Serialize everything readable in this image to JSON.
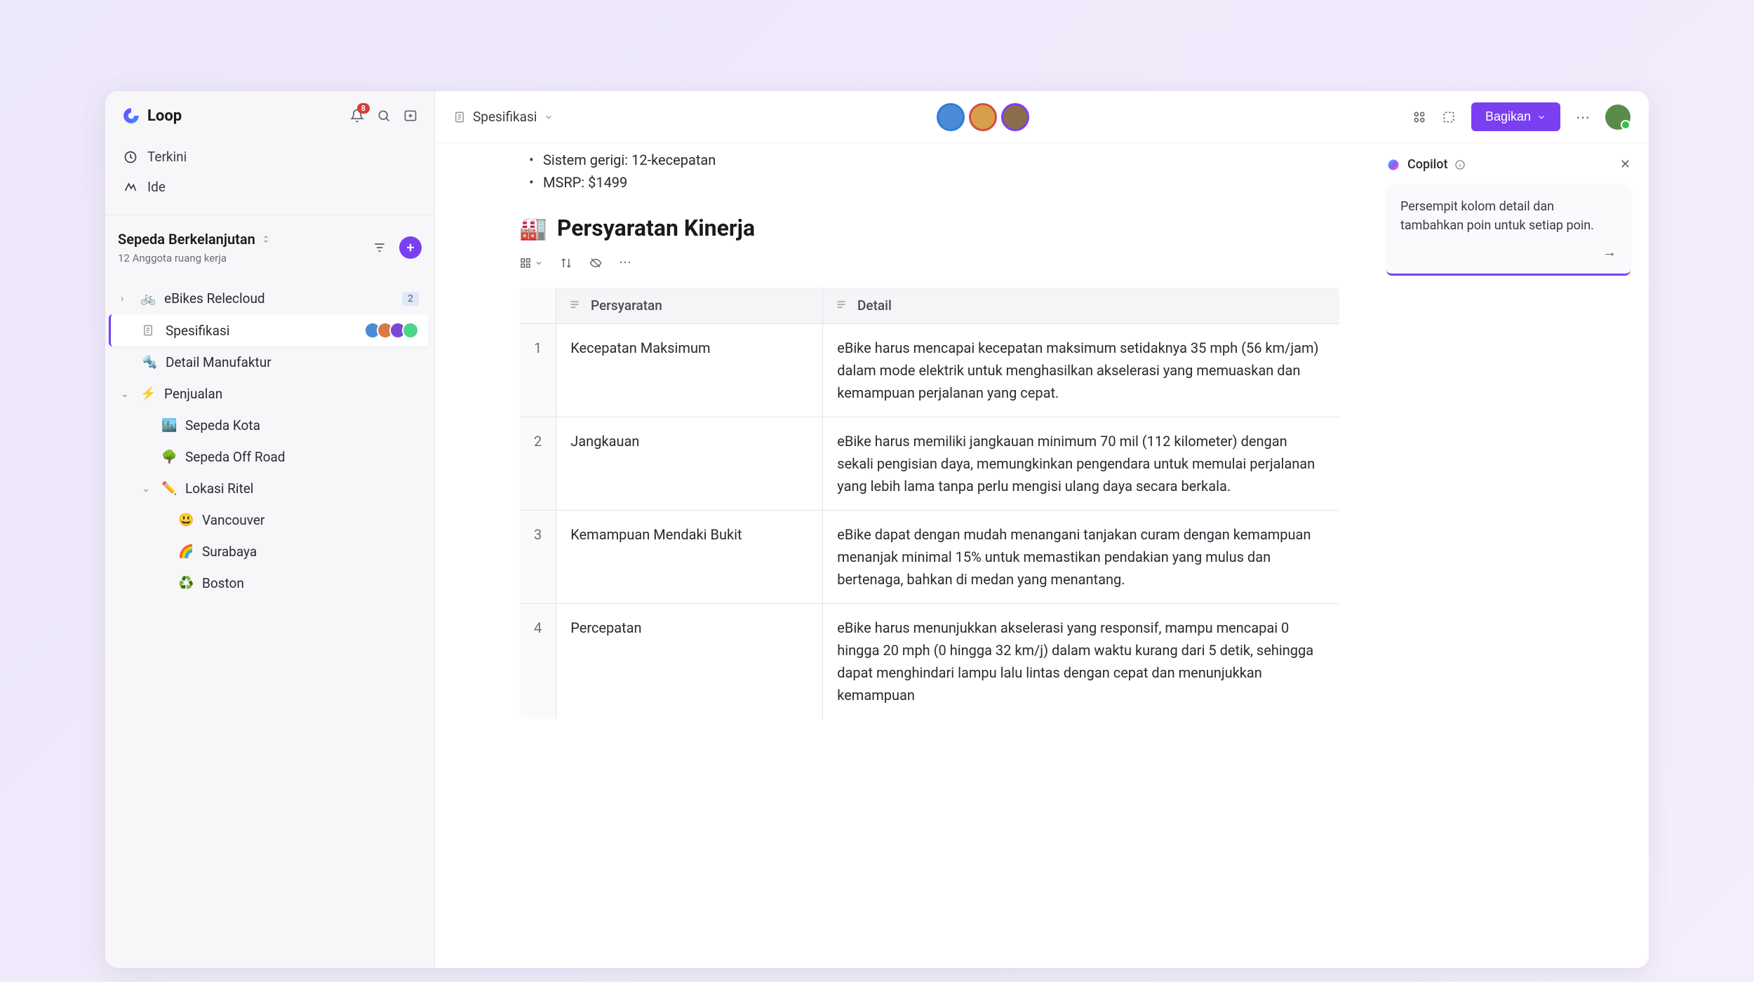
{
  "app": {
    "name": "Loop",
    "notif_count": "8"
  },
  "sidebar_nav": {
    "recent": "Terkini",
    "ideas": "Ide"
  },
  "workspace": {
    "title": "Sepeda Berkelanjutan",
    "subtitle": "12 Anggota ruang kerja"
  },
  "tree": {
    "ebikes": {
      "label": "eBikes Relecloud",
      "badge": "2"
    },
    "spec": {
      "label": "Spesifikasi"
    },
    "manuf": {
      "label": "Detail Manufaktur"
    },
    "sales": {
      "label": "Penjualan"
    },
    "city": {
      "label": "Sepeda Kota"
    },
    "offroad": {
      "label": "Sepeda Off Road"
    },
    "retail": {
      "label": "Lokasi Ritel"
    },
    "vancouver": {
      "label": "Vancouver"
    },
    "surabaya": {
      "label": "Surabaya"
    },
    "boston": {
      "label": "Boston"
    }
  },
  "topbar": {
    "breadcrumb": "Spesifikasi",
    "share": "Bagikan"
  },
  "doc": {
    "bullets": {
      "b1": "Sistem gerigi: 12-kecepatan",
      "b2": "MSRP: $1499"
    },
    "heading": "Persyaratan Kinerja",
    "table": {
      "headers": {
        "req": "Persyaratan",
        "detail": "Detail"
      },
      "rows": [
        {
          "n": "1",
          "req": "Kecepatan Maksimum",
          "detail": "eBike harus mencapai kecepatan maksimum setidaknya 35 mph (56 km/jam) dalam mode elektrik untuk menghasilkan akselerasi yang memuaskan dan kemampuan perjalanan yang cepat."
        },
        {
          "n": "2",
          "req": "Jangkauan",
          "detail": "eBike harus memiliki jangkauan minimum 70 mil (112 kilometer) dengan sekali pengisian daya, memungkinkan pengendara untuk memulai perjalanan yang lebih lama tanpa perlu mengisi ulang daya secara berkala."
        },
        {
          "n": "3",
          "req": "Kemampuan Mendaki Bukit",
          "detail": "eBike dapat dengan mudah menangani tanjakan curam dengan kemampuan menanjak minimal 15% untuk memastikan pendakian yang mulus dan bertenaga, bahkan di medan yang menantang."
        },
        {
          "n": "4",
          "req": "Percepatan",
          "detail": "eBike harus menunjukkan akselerasi yang responsif, mampu mencapai 0 hingga 20 mph (0 hingga 32 km/j) dalam waktu kurang dari 5 detik, sehingga dapat menghindari lampu lalu lintas dengan cepat dan menunjukkan kemampuan"
        }
      ]
    }
  },
  "copilot": {
    "title": "Copilot",
    "prompt": "Persempit kolom detail dan tambahkan poin untuk setiap poin."
  }
}
